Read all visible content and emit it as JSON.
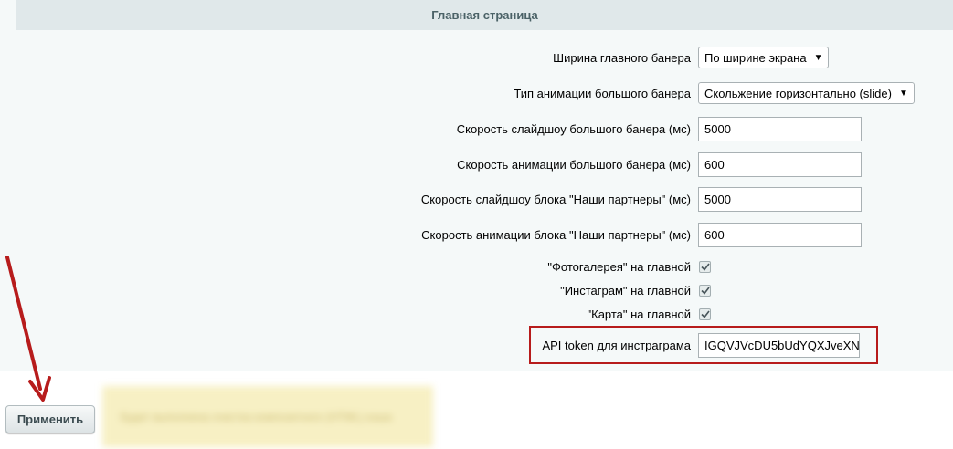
{
  "section": {
    "title": "Главная страница"
  },
  "rows": {
    "banner_width": {
      "label": "Ширина главного банера",
      "value": "По ширине экрана"
    },
    "banner_animation": {
      "label": "Тип анимации большого банера",
      "value": "Скольжение горизонтально (slide)"
    },
    "banner_slideshow_speed": {
      "label": "Скорость слайдшоу большого банера (мс)",
      "value": "5000"
    },
    "banner_animation_speed": {
      "label": "Скорость анимации большого банера (мс)",
      "value": "600"
    },
    "partners_slideshow_speed": {
      "label": "Скорость слайдшоу блока \"Наши партнеры\" (мс)",
      "value": "5000"
    },
    "partners_animation_speed": {
      "label": "Скорость анимации блока \"Наши партнеры\" (мс)",
      "value": "600"
    },
    "gallery_on_main": {
      "label": "\"Фотогалерея\" на главной",
      "checked": true
    },
    "instagram_on_main": {
      "label": "\"Инстаграм\" на главной",
      "checked": true
    },
    "map_on_main": {
      "label": "\"Карта\" на главной",
      "checked": true
    },
    "api_token": {
      "label": "API token для инстраграма",
      "value": "IGQVJVcDU5bUdYQXJveXN"
    }
  },
  "footer": {
    "apply_label": "Применить",
    "notice_text": "Будет выполнена очистка композитного (HTML) кэша"
  },
  "colors": {
    "highlight": "#b71c1c",
    "arrow": "#b71c1c"
  }
}
